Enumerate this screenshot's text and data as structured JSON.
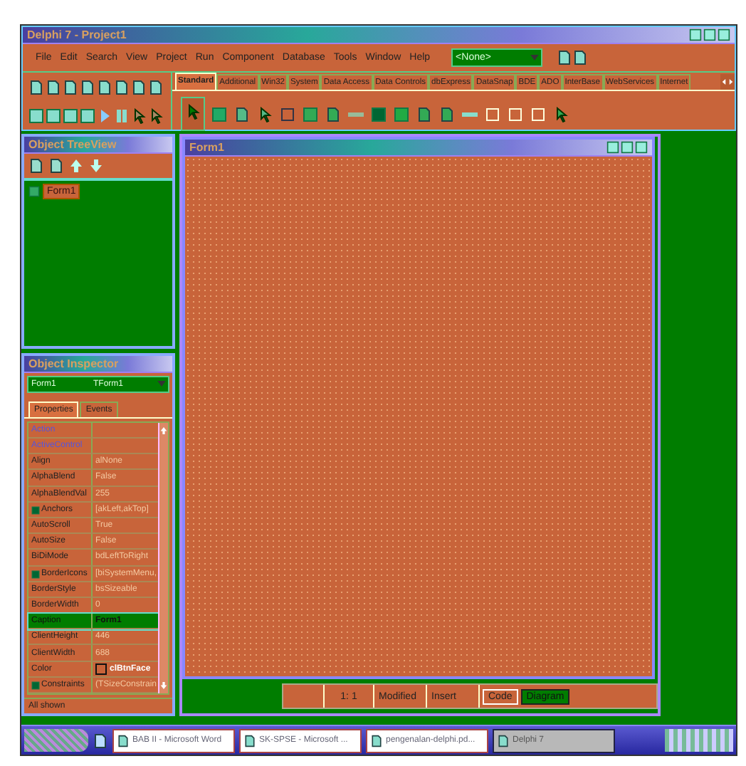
{
  "main_window": {
    "title": "Delphi 7 - Project1",
    "menu": [
      "File",
      "Edit",
      "Search",
      "View",
      "Project",
      "Run",
      "Component",
      "Database",
      "Tools",
      "Window",
      "Help"
    ],
    "component_dropdown": {
      "value": "<None>"
    },
    "palette_tabs": [
      {
        "label": "Standard",
        "selected": true
      },
      {
        "label": "Additional",
        "selected": false
      },
      {
        "label": "Win32",
        "selected": false
      },
      {
        "label": "System",
        "selected": false
      },
      {
        "label": "Data Access",
        "selected": false
      },
      {
        "label": "Data Controls",
        "selected": false
      },
      {
        "label": "dbExpress",
        "selected": false
      },
      {
        "label": "DataSnap",
        "selected": false
      },
      {
        "label": "BDE",
        "selected": false
      },
      {
        "label": "ADO",
        "selected": false
      },
      {
        "label": "InterBase",
        "selected": false
      },
      {
        "label": "WebServices",
        "selected": false
      },
      {
        "label": "Internet",
        "selected": false
      }
    ]
  },
  "tree_view": {
    "title": "Object TreeView",
    "items": [
      {
        "label": "Form1",
        "selected": true
      }
    ]
  },
  "object_inspector": {
    "title": "Object Inspector",
    "object": {
      "name": "Form1",
      "type": "TForm1"
    },
    "tabs": [
      {
        "label": "Properties",
        "selected": true
      },
      {
        "label": "Events",
        "selected": false
      }
    ],
    "properties": [
      {
        "name": "Action",
        "kind": "link",
        "selected": false
      },
      {
        "name": "ActiveControl",
        "kind": "link",
        "selected": false
      },
      {
        "name": "Align",
        "value": "alNone",
        "kind": "plain",
        "selected": false
      },
      {
        "name": "AlphaBlend",
        "value": "False",
        "kind": "plain",
        "selected": false
      },
      {
        "name": "AlphaBlendVal",
        "value": "255",
        "kind": "plain",
        "selected": false
      },
      {
        "name": "Anchors",
        "value": "[akLeft,akTop]",
        "kind": "set",
        "selected": false
      },
      {
        "name": "AutoScroll",
        "value": "True",
        "kind": "plain",
        "selected": false
      },
      {
        "name": "AutoSize",
        "value": "False",
        "kind": "plain",
        "selected": false
      },
      {
        "name": "BiDiMode",
        "value": "bdLeftToRight",
        "kind": "plain",
        "selected": false
      },
      {
        "name": "BorderIcons",
        "value": "[biSystemMenu,",
        "kind": "set",
        "selected": false
      },
      {
        "name": "BorderStyle",
        "value": "bsSizeable",
        "kind": "plain",
        "selected": false
      },
      {
        "name": "BorderWidth",
        "value": "0",
        "kind": "plain",
        "selected": false
      },
      {
        "name": "Caption",
        "value": "Form1",
        "kind": "plain",
        "selected": true
      },
      {
        "name": "ClientHeight",
        "value": "446",
        "kind": "plain",
        "selected": false
      },
      {
        "name": "ClientWidth",
        "value": "688",
        "kind": "plain",
        "selected": false
      },
      {
        "name": "Color",
        "value": "clBtnFace",
        "kind": "color",
        "selected": false
      },
      {
        "name": "Constraints",
        "value": "(TSizeConstrain",
        "kind": "set",
        "selected": false
      }
    ],
    "status": "All shown"
  },
  "form_designer": {
    "title": "Form1"
  },
  "code_editor": {
    "status": [
      "1:  1",
      "Modified",
      "Insert"
    ],
    "tabs": [
      {
        "label": "Code",
        "selected": true
      },
      {
        "label": "Diagram",
        "selected": false
      }
    ]
  },
  "taskbar": {
    "tasks": [
      {
        "label": "BAB II - Microsoft Word",
        "selected": false
      },
      {
        "label": "SK-SPSE - Microsoft ...",
        "selected": false
      },
      {
        "label": "pengenalan-delphi.pd...",
        "selected": false
      },
      {
        "label": "Delphi 7",
        "selected": true
      }
    ]
  }
}
